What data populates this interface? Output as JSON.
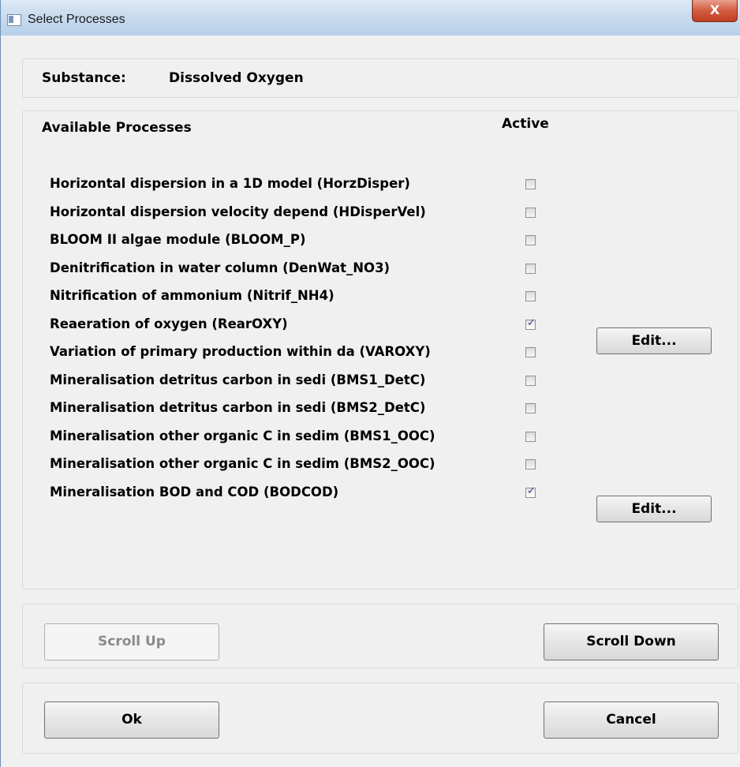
{
  "window": {
    "title": "Select Processes",
    "close_label": "X"
  },
  "substance": {
    "label": "Substance:",
    "value": "Dissolved Oxygen"
  },
  "processes": {
    "header": "Available Processes",
    "active_header": "Active",
    "edit_label": "Edit...",
    "items": [
      {
        "label": "Horizontal dispersion in a 1D model (HorzDisper)",
        "active": false
      },
      {
        "label": "Horizontal dispersion velocity depend (HDisperVel)",
        "active": false
      },
      {
        "label": "BLOOM II algae module (BLOOM_P)",
        "active": false
      },
      {
        "label": "Denitrification in water column (DenWat_NO3)",
        "active": false
      },
      {
        "label": "Nitrification of ammonium (Nitrif_NH4)",
        "active": false
      },
      {
        "label": "Reaeration of oxygen (RearOXY)",
        "active": true
      },
      {
        "label": "Variation of primary production within da (VAROXY)",
        "active": false
      },
      {
        "label": "Mineralisation detritus carbon in sedi (BMS1_DetC)",
        "active": false
      },
      {
        "label": "Mineralisation detritus carbon in sedi (BMS2_DetC)",
        "active": false
      },
      {
        "label": "Mineralisation other organic C in sedim (BMS1_OOC)",
        "active": false
      },
      {
        "label": "Mineralisation other organic C in sedim (BMS2_OOC)",
        "active": false
      },
      {
        "label": "Mineralisation BOD and COD (BODCOD)",
        "active": true
      }
    ]
  },
  "scroll": {
    "up_label": "Scroll Up",
    "down_label": "Scroll Down"
  },
  "footer": {
    "ok_label": "Ok",
    "cancel_label": "Cancel"
  }
}
